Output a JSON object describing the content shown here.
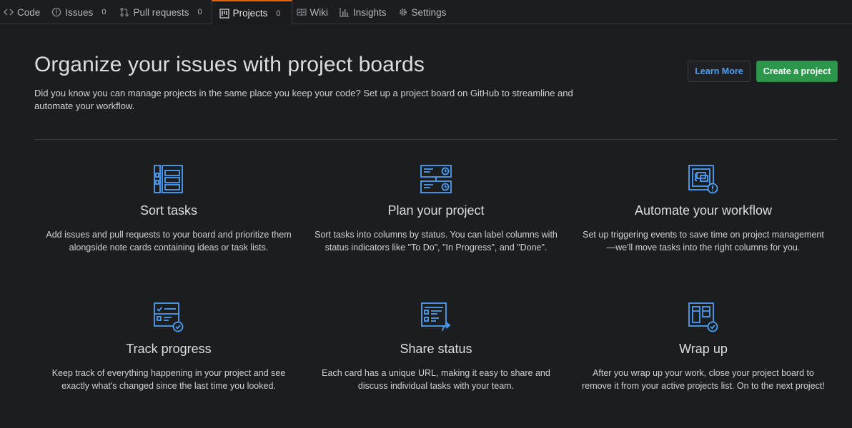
{
  "tabs": [
    {
      "label": "Code",
      "icon": "code-icon"
    },
    {
      "label": "Issues",
      "icon": "issue-icon",
      "count": "0"
    },
    {
      "label": "Pull requests",
      "icon": "pull-request-icon",
      "count": "0"
    },
    {
      "label": "Projects",
      "icon": "project-icon",
      "count": "0",
      "selected": true
    },
    {
      "label": "Wiki",
      "icon": "book-icon"
    },
    {
      "label": "Insights",
      "icon": "graph-icon"
    },
    {
      "label": "Settings",
      "icon": "gear-icon"
    }
  ],
  "header": {
    "title": "Organize your issues with project boards",
    "description": "Did you know you can manage projects in the same place you keep your code? Set up a project board on GitHub to streamline and automate your workflow.",
    "learn_more_label": "Learn More",
    "create_label": "Create a project"
  },
  "features": [
    {
      "title": "Sort tasks",
      "icon": "sort-tasks-icon",
      "description": "Add issues and pull requests to your board and prioritize them alongside note cards containing ideas or task lists."
    },
    {
      "title": "Plan your project",
      "icon": "plan-project-icon",
      "description": "Sort tasks into columns by status. You can label columns with status indicators like \"To Do\", \"In Progress\", and \"Done\"."
    },
    {
      "title": "Automate your workflow",
      "icon": "automate-workflow-icon",
      "description": "Set up triggering events to save time on project management—we'll move tasks into the right columns for you."
    },
    {
      "title": "Track progress",
      "icon": "track-progress-icon",
      "description": "Keep track of everything happening in your project and see exactly what's changed since the last time you looked."
    },
    {
      "title": "Share status",
      "icon": "share-status-icon",
      "description": "Each card has a unique URL, making it easy to share and discuss individual tasks with your team."
    },
    {
      "title": "Wrap up",
      "icon": "wrap-up-icon",
      "description": "After you wrap up your work, close your project board to remove it from your active projects list. On to the next project!"
    }
  ],
  "colors": {
    "background": "#1c1d1f",
    "accent_icon": "#4a9ff5",
    "selected_tab_border": "#e36209",
    "create_button": "#2c974b"
  }
}
